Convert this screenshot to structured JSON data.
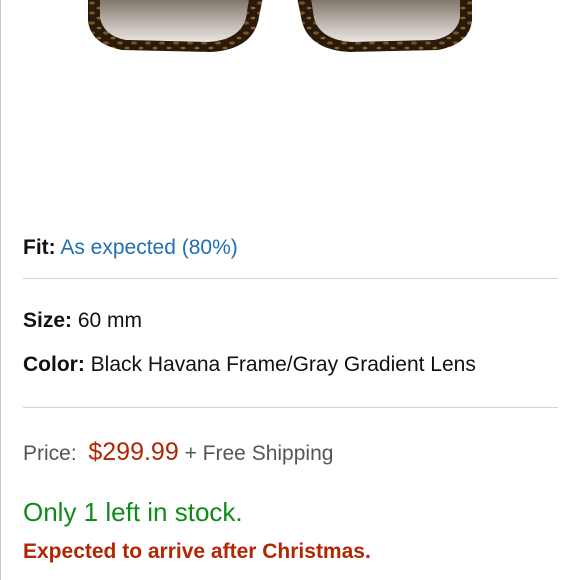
{
  "product_image": {
    "icon": "sunglasses-image",
    "frame_color": "#2a1a0c",
    "frame_accent": "#7a5420"
  },
  "fit": {
    "label": "Fit:",
    "value": "As expected (80%)"
  },
  "size": {
    "label": "Size:",
    "value": "60 mm"
  },
  "color": {
    "label": "Color:",
    "value": "Black Havana Frame/Gray Gradient Lens"
  },
  "price": {
    "label": "Price:",
    "value": "$299.99",
    "shipping": "+ Free Shipping"
  },
  "stock": {
    "text": "Only 1 left in stock."
  },
  "arrival": {
    "text": "Expected to arrive after Christmas."
  },
  "colors": {
    "link": "#1f6fb2",
    "price": "#b12704",
    "stock": "#118a1b",
    "arrival": "#b12704"
  }
}
